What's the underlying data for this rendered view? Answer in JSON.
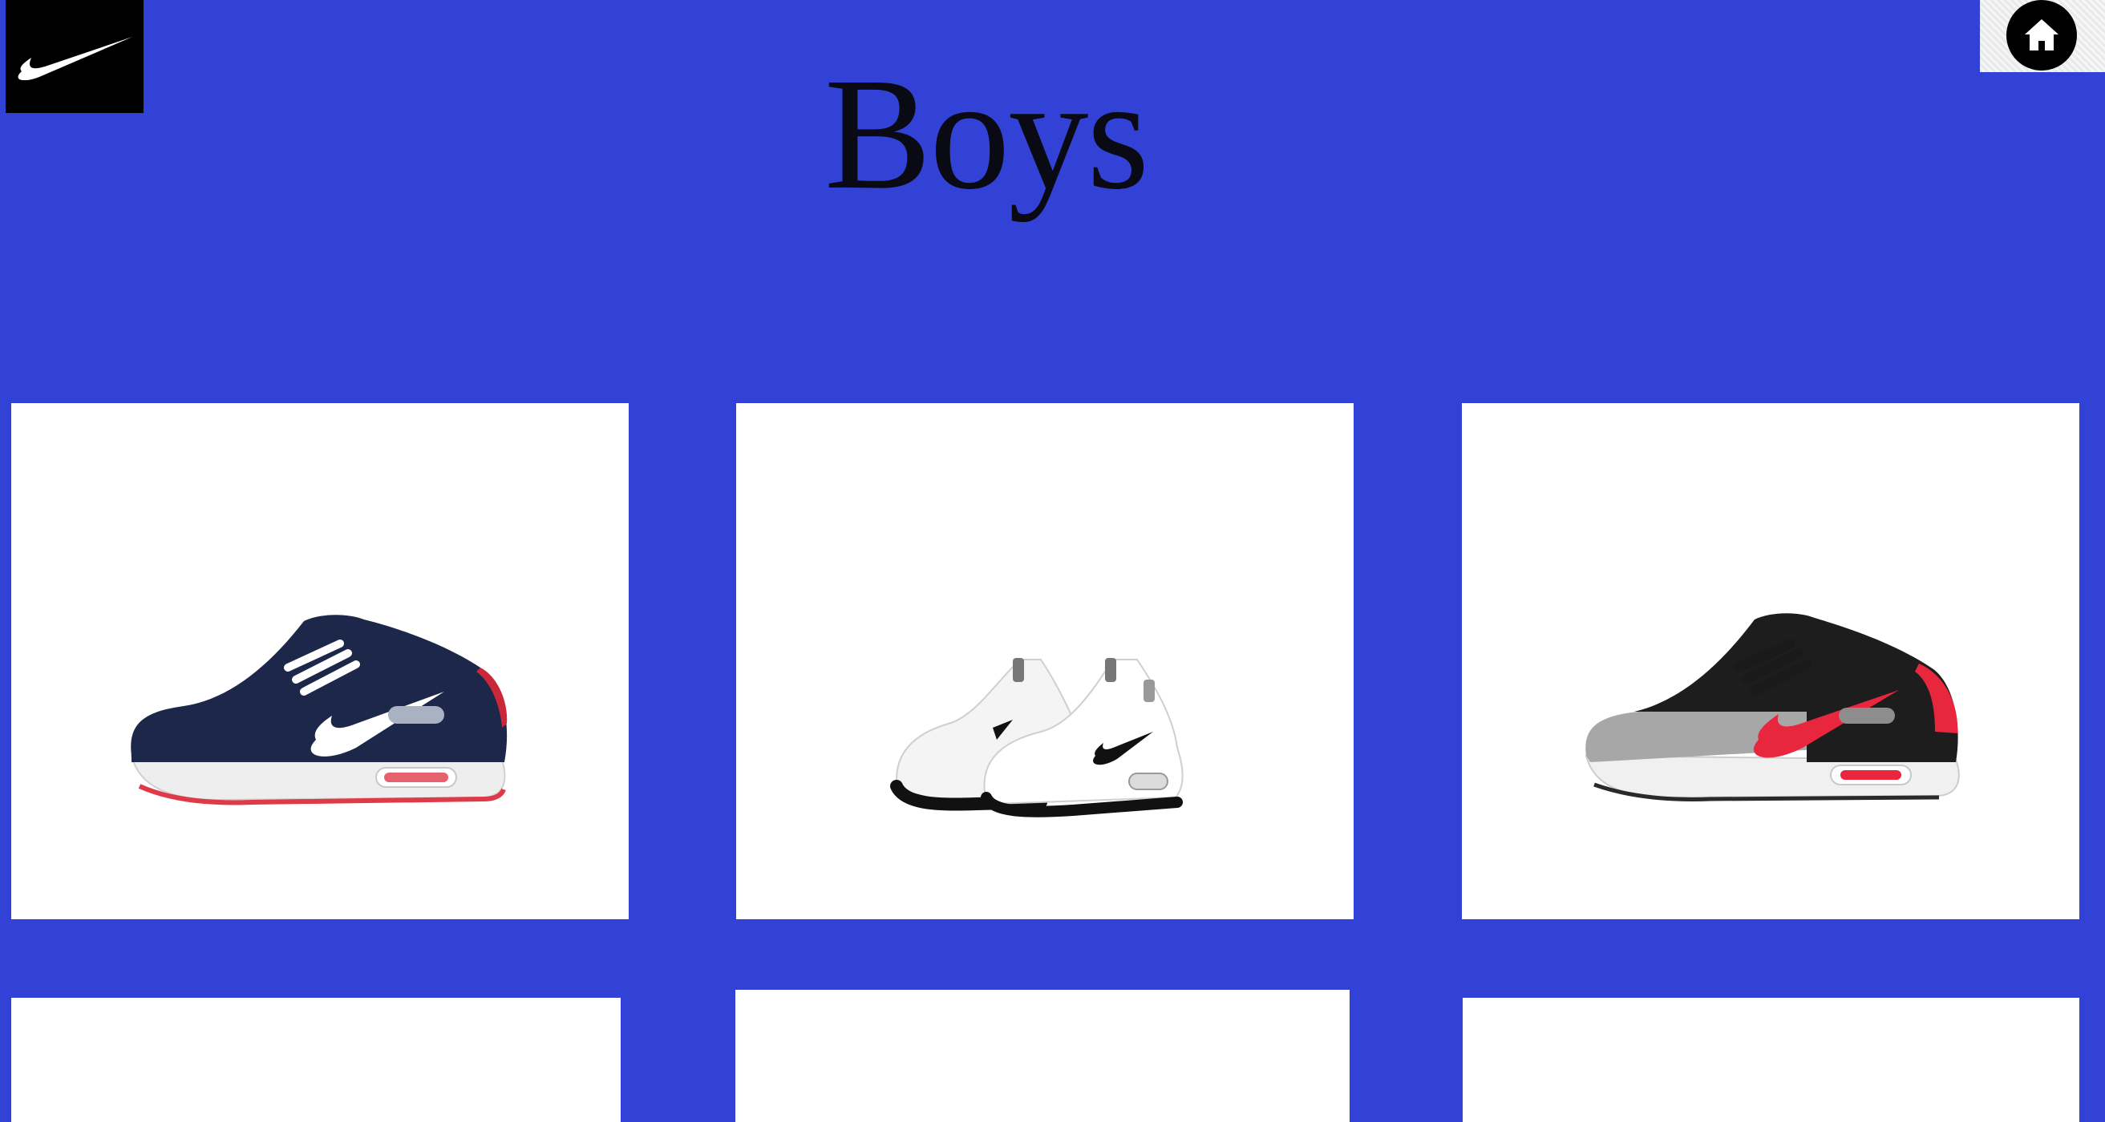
{
  "header": {
    "brand_logo": "nike-swoosh-icon",
    "home_icon": "home-icon",
    "title": "Boys"
  },
  "colors": {
    "background": "#3342d6",
    "card": "#ffffff",
    "logo_bg": "#000000",
    "title": "#0a0a14"
  },
  "products": [
    {
      "image": "navy-white-red-sneaker"
    },
    {
      "image": "white-black-sneakers-pair"
    },
    {
      "image": "black-grey-red-sneaker"
    },
    {
      "image": ""
    },
    {
      "image": ""
    },
    {
      "image": ""
    }
  ]
}
